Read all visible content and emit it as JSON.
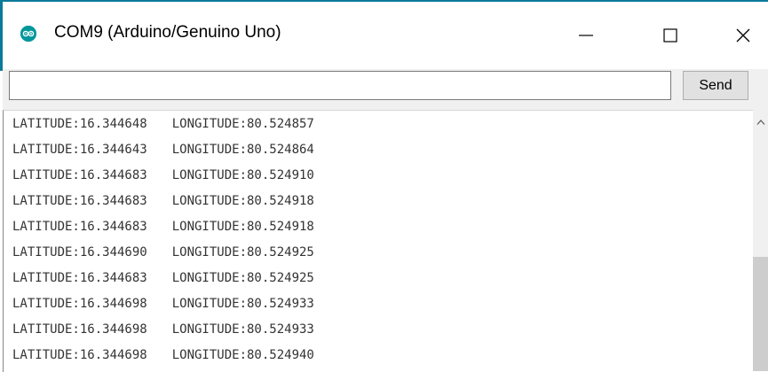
{
  "window": {
    "title": "COM9 (Arduino/Genuino Uno)"
  },
  "toolbar": {
    "input_value": "",
    "send_label": "Send"
  },
  "output": {
    "lines": [
      {
        "lat": "LATITUDE:16.344648",
        "lon": "LONGITUDE:80.524857"
      },
      {
        "lat": "LATITUDE:16.344643",
        "lon": "LONGITUDE:80.524864"
      },
      {
        "lat": "LATITUDE:16.344683",
        "lon": "LONGITUDE:80.524910"
      },
      {
        "lat": "LATITUDE:16.344683",
        "lon": "LONGITUDE:80.524918"
      },
      {
        "lat": "LATITUDE:16.344683",
        "lon": "LONGITUDE:80.524918"
      },
      {
        "lat": "LATITUDE:16.344690",
        "lon": "LONGITUDE:80.524925"
      },
      {
        "lat": "LATITUDE:16.344683",
        "lon": "LONGITUDE:80.524925"
      },
      {
        "lat": "LATITUDE:16.344698",
        "lon": "LONGITUDE:80.524933"
      },
      {
        "lat": "LATITUDE:16.344698",
        "lon": "LONGITUDE:80.524933"
      },
      {
        "lat": "LATITUDE:16.344698",
        "lon": "LONGITUDE:80.524940"
      }
    ]
  },
  "icons": {
    "app": "arduino-icon",
    "minimize": "minimize-icon",
    "maximize": "maximize-icon",
    "close": "close-icon",
    "scroll_up": "chevron-up-icon"
  },
  "colors": {
    "accent": "#0b7a9a",
    "arduino_teal": "#00979c"
  }
}
